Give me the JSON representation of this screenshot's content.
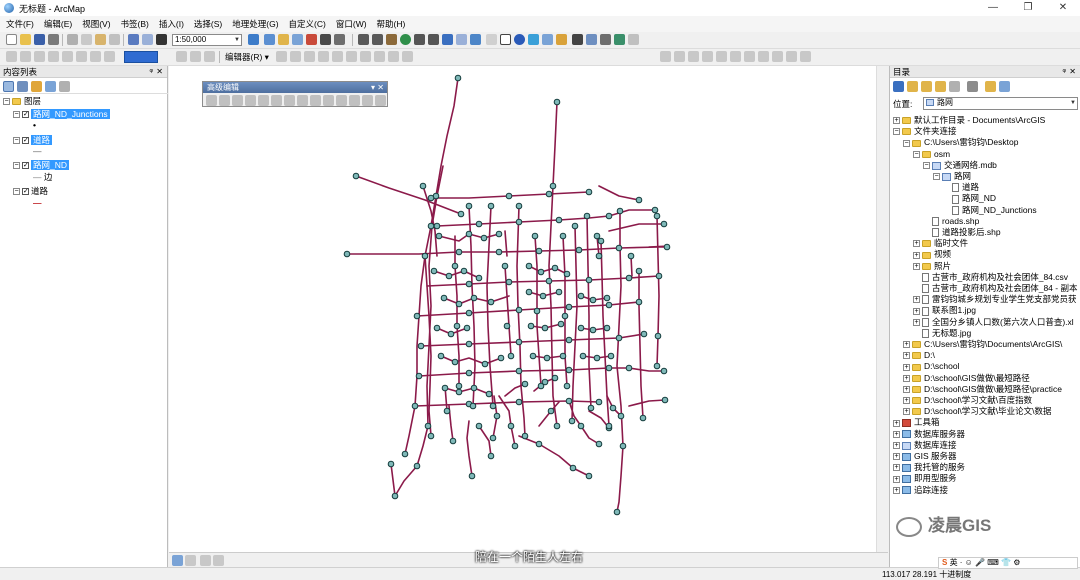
{
  "window": {
    "title": "无标题 - ArcMap"
  },
  "menu": [
    "文件(F)",
    "编辑(E)",
    "视图(V)",
    "书签(B)",
    "插入(I)",
    "选择(S)",
    "地理处理(G)",
    "自定义(C)",
    "窗口(W)",
    "帮助(H)"
  ],
  "toolbar": {
    "scale": "1:50,000",
    "editor_label": "编辑器(R) ▾"
  },
  "toc": {
    "title": "内容列表",
    "root": "图层",
    "layers": [
      {
        "name": "路网_ND_Junctions",
        "legend": "•"
      },
      {
        "name": "道路",
        "legend": "—"
      },
      {
        "name": "路网_ND",
        "legend": "边"
      },
      {
        "name": "道路",
        "legend": "—"
      }
    ]
  },
  "advanced_edit": {
    "title": "高级编辑"
  },
  "catalog": {
    "title": "目录",
    "location_label": "位置:",
    "location_value": "路网",
    "items": [
      {
        "text": "默认工作目录 - Documents\\ArcGIS",
        "indent": 0,
        "pm": "+",
        "icon": "folder"
      },
      {
        "text": "文件夹连接",
        "indent": 0,
        "pm": "-",
        "icon": "folder"
      },
      {
        "text": "C:\\Users\\雷钧钧\\Desktop",
        "indent": 1,
        "pm": "-",
        "icon": "folder"
      },
      {
        "text": "osm",
        "indent": 2,
        "pm": "-",
        "icon": "folder"
      },
      {
        "text": "交通网络.mdb",
        "indent": 3,
        "pm": "-",
        "icon": "db"
      },
      {
        "text": "路网",
        "indent": 4,
        "pm": "-",
        "icon": "db"
      },
      {
        "text": "道路",
        "indent": 5,
        "pm": "",
        "icon": "file"
      },
      {
        "text": "路网_ND",
        "indent": 5,
        "pm": "",
        "icon": "file"
      },
      {
        "text": "路网_ND_Junctions",
        "indent": 5,
        "pm": "",
        "icon": "file"
      },
      {
        "text": "roads.shp",
        "indent": 3,
        "pm": "",
        "icon": "file"
      },
      {
        "text": "道路投影后.shp",
        "indent": 3,
        "pm": "",
        "icon": "file"
      },
      {
        "text": "临时文件",
        "indent": 2,
        "pm": "+",
        "icon": "folder"
      },
      {
        "text": "视频",
        "indent": 2,
        "pm": "+",
        "icon": "folder"
      },
      {
        "text": "照片",
        "indent": 2,
        "pm": "+",
        "icon": "folder"
      },
      {
        "text": "古营市_政府机构及社会团体_84.csv",
        "indent": 2,
        "pm": "",
        "icon": "file"
      },
      {
        "text": "古营市_政府机构及社会团体_84 - 副本",
        "indent": 2,
        "pm": "",
        "icon": "file"
      },
      {
        "text": "雷钧钧城乡规划专业学生党支部党员获",
        "indent": 2,
        "pm": "+",
        "icon": "file"
      },
      {
        "text": "联系图1.jpg",
        "indent": 2,
        "pm": "+",
        "icon": "file"
      },
      {
        "text": "全国分乡镇人口数(第六次人口普查).xl",
        "indent": 2,
        "pm": "+",
        "icon": "file"
      },
      {
        "text": "无标题.jpg",
        "indent": 2,
        "pm": "",
        "icon": "file"
      },
      {
        "text": "C:\\Users\\雷钧钧\\Documents\\ArcGIS\\",
        "indent": 1,
        "pm": "+",
        "icon": "folder"
      },
      {
        "text": "D:\\",
        "indent": 1,
        "pm": "+",
        "icon": "folder"
      },
      {
        "text": "D:\\school",
        "indent": 1,
        "pm": "+",
        "icon": "folder"
      },
      {
        "text": "D:\\school\\GIS做做\\最短路径",
        "indent": 1,
        "pm": "+",
        "icon": "folder"
      },
      {
        "text": "D:\\school\\GIS做做\\最短路径\\practice",
        "indent": 1,
        "pm": "+",
        "icon": "folder"
      },
      {
        "text": "D:\\school\\学习文献\\百度指数",
        "indent": 1,
        "pm": "+",
        "icon": "folder"
      },
      {
        "text": "D:\\school\\学习文献\\毕业论文\\数据",
        "indent": 1,
        "pm": "+",
        "icon": "folder"
      },
      {
        "text": "工具箱",
        "indent": 0,
        "pm": "+",
        "icon": "tool"
      },
      {
        "text": "数据库服务器",
        "indent": 0,
        "pm": "+",
        "icon": "server"
      },
      {
        "text": "数据库连接",
        "indent": 0,
        "pm": "+",
        "icon": "db"
      },
      {
        "text": "GIS 服务器",
        "indent": 0,
        "pm": "+",
        "icon": "server"
      },
      {
        "text": "我托管的服务",
        "indent": 0,
        "pm": "+",
        "icon": "server"
      },
      {
        "text": "即用型服务",
        "indent": 0,
        "pm": "+",
        "icon": "server"
      },
      {
        "text": "追踪连接",
        "indent": 0,
        "pm": "+",
        "icon": "server"
      }
    ]
  },
  "status": {
    "coords": "113.017  28.191  十进制度"
  },
  "subtitle": "陪在一个陌生人左右",
  "watermark": "凌晨GIS",
  "ime": "英 · ☺ 🎤 ⌨ 👕 ⚙",
  "colors": {
    "road": "#8b1a4a",
    "junction_fill": "#7fb8b8",
    "junction_stroke": "#143c3c",
    "selection": "#3399ff"
  }
}
